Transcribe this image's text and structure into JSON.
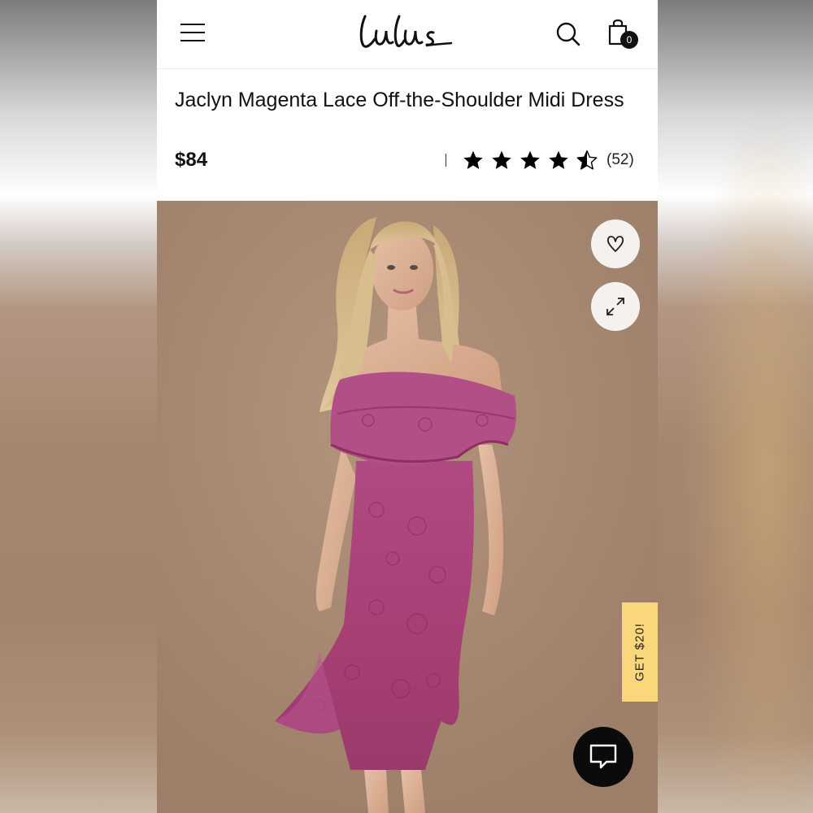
{
  "header": {
    "brand": "Lulus",
    "cart_count": "0",
    "icons": [
      "menu-icon",
      "search-icon",
      "shopping-bag-icon"
    ]
  },
  "product": {
    "title": "Jaclyn Magenta Lace Off-the-Shoulder Midi Dress",
    "price": "$84",
    "rating": 4,
    "rating_max": 5,
    "review_count": "(52)"
  },
  "image": {
    "actions": [
      "heart-icon",
      "expand-icon"
    ]
  },
  "promo": {
    "label": "GET $20!"
  },
  "chat": {
    "icon": "chat-icon"
  },
  "colors": {
    "promo": "#fad77a",
    "dress": "#a63f74",
    "photo_background": "#a68a74",
    "chat": "#0b0b0b"
  }
}
